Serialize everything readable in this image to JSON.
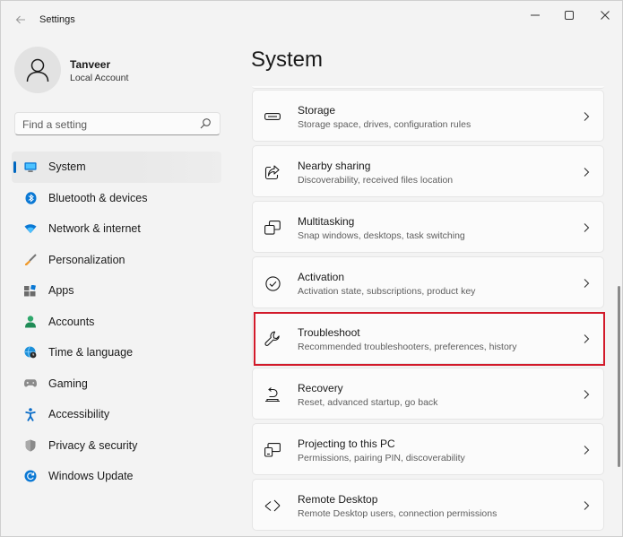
{
  "window": {
    "title": "Settings"
  },
  "profile": {
    "name": "Tanveer",
    "account_type": "Local Account"
  },
  "search": {
    "placeholder": "Find a setting"
  },
  "nav": [
    {
      "label": "System",
      "icon": "monitor-icon",
      "active": true
    },
    {
      "label": "Bluetooth & devices",
      "icon": "bluetooth-icon"
    },
    {
      "label": "Network & internet",
      "icon": "wifi-icon"
    },
    {
      "label": "Personalization",
      "icon": "brush-icon"
    },
    {
      "label": "Apps",
      "icon": "apps-icon"
    },
    {
      "label": "Accounts",
      "icon": "person-icon"
    },
    {
      "label": "Time & language",
      "icon": "globe-clock-icon"
    },
    {
      "label": "Gaming",
      "icon": "gamepad-icon"
    },
    {
      "label": "Accessibility",
      "icon": "accessibility-icon"
    },
    {
      "label": "Privacy & security",
      "icon": "shield-icon"
    },
    {
      "label": "Windows Update",
      "icon": "update-icon"
    }
  ],
  "main": {
    "title": "System",
    "cards": [
      {
        "title": "Storage",
        "subtitle": "Storage space, drives, configuration rules",
        "icon": "storage-icon"
      },
      {
        "title": "Nearby sharing",
        "subtitle": "Discoverability, received files location",
        "icon": "share-icon"
      },
      {
        "title": "Multitasking",
        "subtitle": "Snap windows, desktops, task switching",
        "icon": "multitasking-icon"
      },
      {
        "title": "Activation",
        "subtitle": "Activation state, subscriptions, product key",
        "icon": "check-circle-icon"
      },
      {
        "title": "Troubleshoot",
        "subtitle": "Recommended troubleshooters, preferences, history",
        "icon": "wrench-icon",
        "highlighted": true
      },
      {
        "title": "Recovery",
        "subtitle": "Reset, advanced startup, go back",
        "icon": "recovery-icon"
      },
      {
        "title": "Projecting to this PC",
        "subtitle": "Permissions, pairing PIN, discoverability",
        "icon": "projecting-icon"
      },
      {
        "title": "Remote Desktop",
        "subtitle": "Remote Desktop users, connection permissions",
        "icon": "remote-desktop-icon"
      }
    ]
  },
  "colors": {
    "accent": "#0067c0",
    "highlight_border": "#d21a2a",
    "background": "#f3f3f3",
    "card": "#fbfbfb"
  }
}
